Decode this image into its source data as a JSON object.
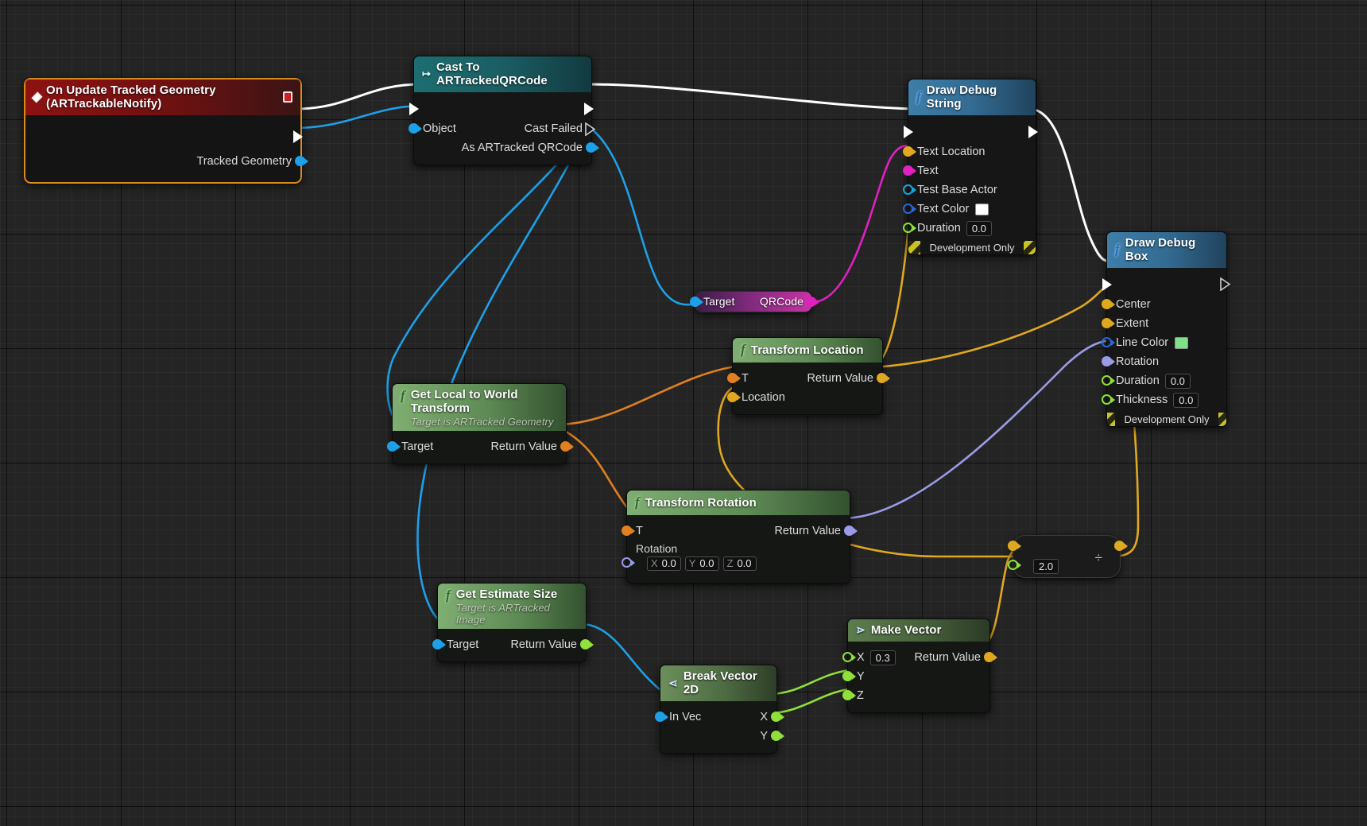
{
  "graph": {
    "title": "Blueprint Event Graph",
    "background": "#242424",
    "wire_colors": {
      "exec": "#ffffff",
      "object": "#1ea0e8",
      "transform": "#e08020",
      "vector": "#e8b820",
      "string": "#e020c0",
      "rotator": "#9a9ae8",
      "float": "#8fe03a"
    }
  },
  "nodes": {
    "event_update": {
      "title": "On Update Tracked Geometry (ARTrackableNotify)",
      "icon": "event-diamond-icon",
      "badge": "red-stop-icon",
      "outputs": [
        {
          "label": "",
          "type": "exec"
        },
        {
          "label": "Tracked Geometry",
          "type": "object"
        }
      ]
    },
    "cast_qrcode": {
      "title": "Cast To ARTrackedQRCode",
      "icon": "cast-arrow-icon",
      "inputs": [
        {
          "label": "",
          "type": "exec"
        },
        {
          "label": "Object",
          "type": "object"
        }
      ],
      "outputs": [
        {
          "label": "",
          "type": "exec"
        },
        {
          "label": "Cast Failed",
          "type": "exec"
        },
        {
          "label": "As ARTracked QRCode",
          "type": "object"
        }
      ]
    },
    "draw_debug_string": {
      "title": "Draw Debug String",
      "icon": "function-f-icon",
      "footer": "Development Only",
      "inputs": [
        {
          "label": "",
          "type": "exec"
        },
        {
          "label": "Text Location",
          "type": "vector"
        },
        {
          "label": "Text",
          "type": "string"
        },
        {
          "label": "Test Base Actor",
          "type": "object-cyan"
        },
        {
          "label": "Text Color",
          "type": "struct-blue",
          "swatch": "#ffffff"
        },
        {
          "label": "Duration",
          "type": "float",
          "value": "0.0"
        }
      ],
      "outputs": [
        {
          "label": "",
          "type": "exec"
        }
      ]
    },
    "draw_debug_box": {
      "title": "Draw Debug Box",
      "icon": "function-f-icon",
      "footer": "Development Only",
      "inputs": [
        {
          "label": "",
          "type": "exec"
        },
        {
          "label": "Center",
          "type": "vector"
        },
        {
          "label": "Extent",
          "type": "vector"
        },
        {
          "label": "Line Color",
          "type": "struct-blue",
          "swatch": "#7fe08a"
        },
        {
          "label": "Rotation",
          "type": "rotator"
        },
        {
          "label": "Duration",
          "type": "float",
          "value": "0.0"
        },
        {
          "label": "Thickness",
          "type": "float",
          "value": "0.0"
        }
      ],
      "outputs": [
        {
          "label": "",
          "type": "exec"
        }
      ]
    },
    "qrcode_knot": {
      "input_label": "Target",
      "output_label": "QRCode"
    },
    "transform_location": {
      "title": "Transform Location",
      "icon": "function-f-icon",
      "inputs": [
        {
          "label": "T",
          "type": "transform"
        },
        {
          "label": "Location",
          "type": "vector"
        }
      ],
      "outputs": [
        {
          "label": "Return Value",
          "type": "vector"
        }
      ]
    },
    "transform_rotation": {
      "title": "Transform Rotation",
      "icon": "function-f-icon",
      "inputs": [
        {
          "label": "T",
          "type": "transform"
        },
        {
          "label": "Rotation",
          "type": "rotator"
        }
      ],
      "rotation_fields": [
        {
          "axis": "X",
          "value": "0.0"
        },
        {
          "axis": "Y",
          "value": "0.0"
        },
        {
          "axis": "Z",
          "value": "0.0"
        }
      ],
      "outputs": [
        {
          "label": "Return Value",
          "type": "rotator"
        }
      ]
    },
    "get_local_to_world": {
      "title": "Get Local to World Transform",
      "subtitle": "Target is ARTracked Geometry",
      "icon": "function-f-icon",
      "inputs": [
        {
          "label": "Target",
          "type": "object"
        }
      ],
      "outputs": [
        {
          "label": "Return Value",
          "type": "transform"
        }
      ]
    },
    "get_estimate_size": {
      "title": "Get Estimate Size",
      "subtitle": "Target is ARTracked Image",
      "icon": "function-f-icon",
      "inputs": [
        {
          "label": "Target",
          "type": "object"
        }
      ],
      "outputs": [
        {
          "label": "Return Value",
          "type": "vector2d"
        }
      ]
    },
    "break_vector_2d": {
      "title": "Break Vector 2D",
      "icon": "break-struct-icon",
      "inputs": [
        {
          "label": "In Vec",
          "type": "object"
        }
      ],
      "outputs": [
        {
          "label": "X",
          "type": "float"
        },
        {
          "label": "Y",
          "type": "float"
        }
      ]
    },
    "make_vector": {
      "title": "Make Vector",
      "icon": "make-struct-icon",
      "inputs": [
        {
          "label": "X",
          "type": "float",
          "value": "0.3"
        },
        {
          "label": "Y",
          "type": "float"
        },
        {
          "label": "Z",
          "type": "float"
        }
      ],
      "outputs": [
        {
          "label": "Return Value",
          "type": "vector"
        }
      ]
    },
    "divide_node": {
      "symbol": "÷",
      "inputs": [
        {
          "label": "",
          "type": "vector"
        },
        {
          "label": "",
          "type": "float",
          "value": "2.0"
        }
      ],
      "outputs": [
        {
          "label": "",
          "type": "vector"
        }
      ]
    }
  }
}
